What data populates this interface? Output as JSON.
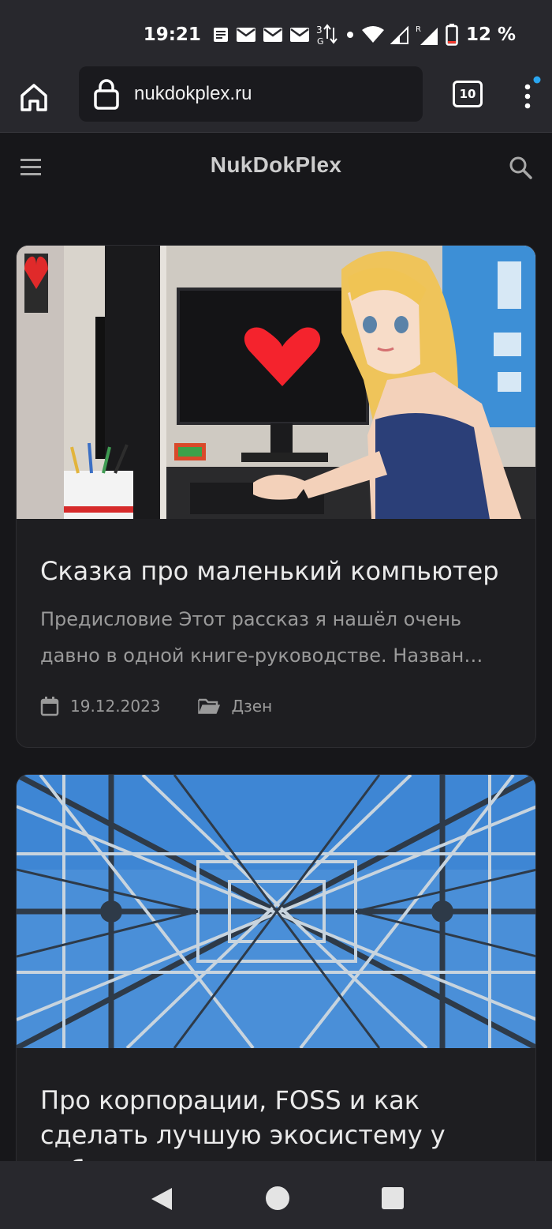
{
  "status_bar": {
    "time": "19:21",
    "battery": "12 %",
    "icons": [
      "notification-news-icon",
      "mail-icon",
      "mail-icon",
      "mail-icon",
      "data-3g-icon",
      "dot-icon",
      "wifi-icon",
      "signal-icon",
      "signal-roaming-icon",
      "battery-icon"
    ]
  },
  "browser": {
    "url": "nukdokplex.ru",
    "tabs_count": "10",
    "menu_badge_color": "#2aa6f0"
  },
  "site": {
    "title": "NukDokPlex"
  },
  "posts": [
    {
      "title": "Сказка про маленький компьютер",
      "excerpt": "Предисловие Этот рассказ я нашёл очень давно в одной книге-руководстве. Назван…",
      "date": "19.12.2023",
      "category": "Дзен"
    },
    {
      "title": "Про корпорации, FOSS и как сделать лучшую экосистему у себ…"
    }
  ],
  "colors": {
    "background": "#17171a",
    "bars": "#28282d",
    "card": "#1e1e21",
    "heart": "#f4232d",
    "sky": "#4a8fd8"
  }
}
